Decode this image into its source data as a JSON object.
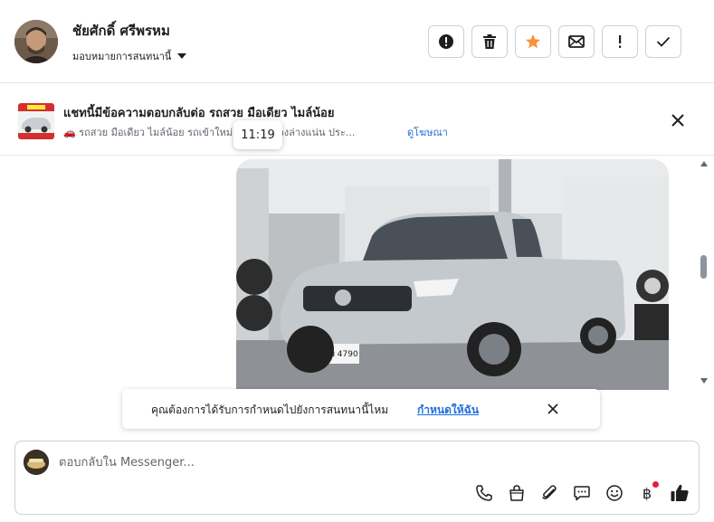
{
  "header": {
    "contact_name": "ชัยศักดิ์ ศรีพรหม",
    "assign_label": "มอบหมายการสนทนานี้",
    "actions": [
      {
        "name": "spam-button",
        "icon": "alert-circle-icon"
      },
      {
        "name": "delete-button",
        "icon": "trash-icon"
      },
      {
        "name": "star-button",
        "icon": "star-icon",
        "color": "#f7923b"
      },
      {
        "name": "mark-unread-button",
        "icon": "envelope-icon"
      },
      {
        "name": "follow-up-button",
        "icon": "exclamation-icon"
      },
      {
        "name": "mark-done-button",
        "icon": "checkmark-icon"
      }
    ]
  },
  "ad_notice": {
    "title": "แชทนี้มีข้อความตอบกลับต่อ รถสวย มือเดียว ไมล์น้อย",
    "subtitle": "🚗 รถสวย มือเดียว ไมล์น้อย รถเข้าใหม่ เครื่องดี ช่วงล่างแน่น ประ...",
    "link": "ดูโฆษณา",
    "tooltip_time": "11:19"
  },
  "assign_toast": {
    "text": "คุณต้องการได้รับการกำหนดไปยังการสนทนานี้ไหม",
    "link": "กำหนดให้ฉัน"
  },
  "composer": {
    "placeholder": "ตอบกลับใน Messenger...",
    "tools": [
      "phone-icon",
      "shopping-bag-icon",
      "paperclip-icon",
      "chat-bubble-icon",
      "emoji-icon",
      "baht-icon",
      "thumbs-up-icon"
    ],
    "baht_symbol": "฿"
  },
  "colors": {
    "link": "#216fdb",
    "border": "#ccd0d5",
    "star": "#f7923b",
    "notification_dot": "#e41e3f"
  }
}
